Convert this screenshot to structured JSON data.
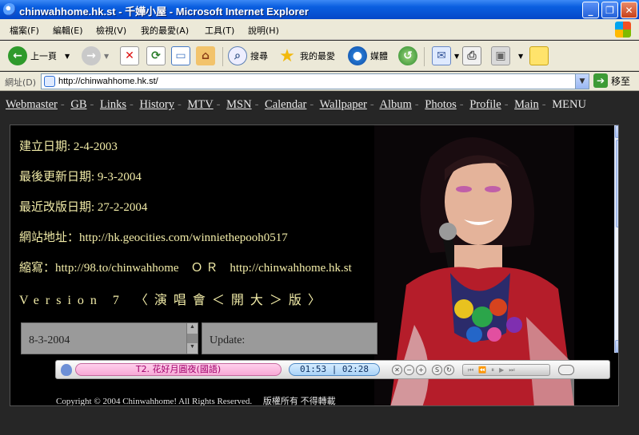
{
  "window": {
    "title": "chinwahhome.hk.st - 千嬅小屋 - Microsoft Internet Explorer"
  },
  "menu": [
    "檔案(F)",
    "編輯(E)",
    "檢視(V)",
    "我的最愛(A)",
    "工具(T)",
    "說明(H)"
  ],
  "toolbar": {
    "back": "上一頁",
    "search": "搜尋",
    "favorites": "我的最愛",
    "media": "媒體"
  },
  "address": {
    "label": "網址(D)",
    "url": "http://chinwahhome.hk.st/",
    "go": "移至"
  },
  "nav": {
    "links": [
      "Webmaster",
      "GB",
      "Links",
      "History",
      "MTV",
      "MSN",
      "Calendar",
      "Wallpaper",
      "Album",
      "Photos",
      "Profile",
      "Main"
    ],
    "menu_label": "MENU"
  },
  "site": {
    "created": "建立日期: 2-4-2003",
    "updated": "最後更新日期:  9-3-2004",
    "revised": "最近改版日期:  27-2-2004",
    "address": "網站地址：http://hk.geocities.com/winniethepooh0517",
    "short": "縮寫：http://98.to/chinwahhome　Ｏ Ｒ　http://chinwahhome.hk.st",
    "version": "Version 7 〈演唱會＜開大＞版〉",
    "box1": "8-3-2004",
    "box2": "Update:",
    "copyright": "Copyright © 2004 Chinwahhome! All Rights Reserved.　 版權所有 不得轉載"
  },
  "player": {
    "track": "T2. 花好月圓夜(國語)",
    "time": "01:53 | 02:28"
  }
}
